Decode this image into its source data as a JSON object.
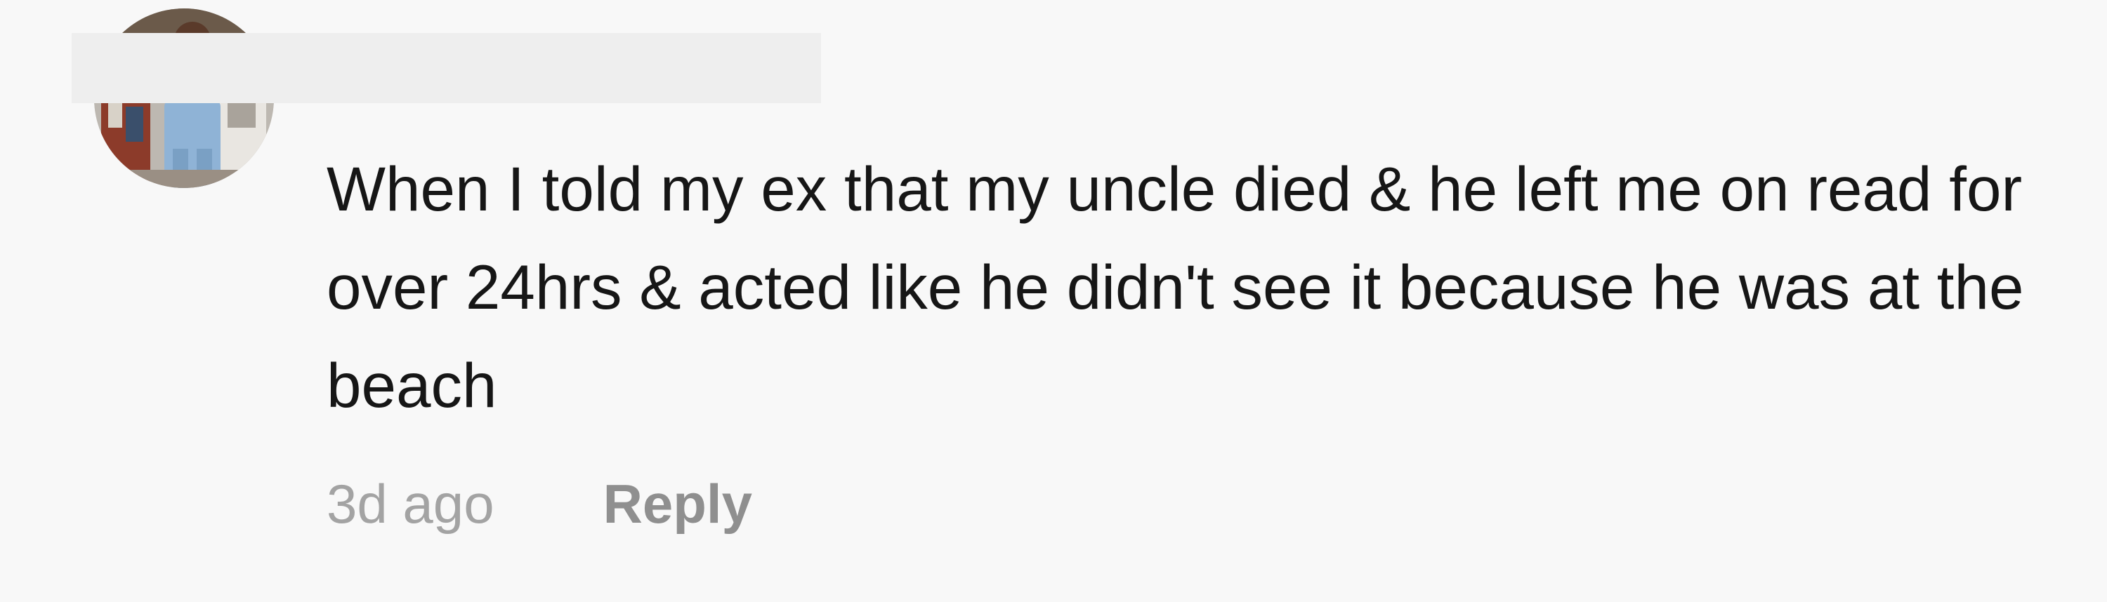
{
  "comment": {
    "avatar": {
      "icon": "user-avatar-photo"
    },
    "text": "When I told my ex that my uncle died & he left me on read for over 24hrs & acted like he didn't see it because he was at the beach",
    "timestamp": "3d ago",
    "reply_label": "Reply"
  }
}
